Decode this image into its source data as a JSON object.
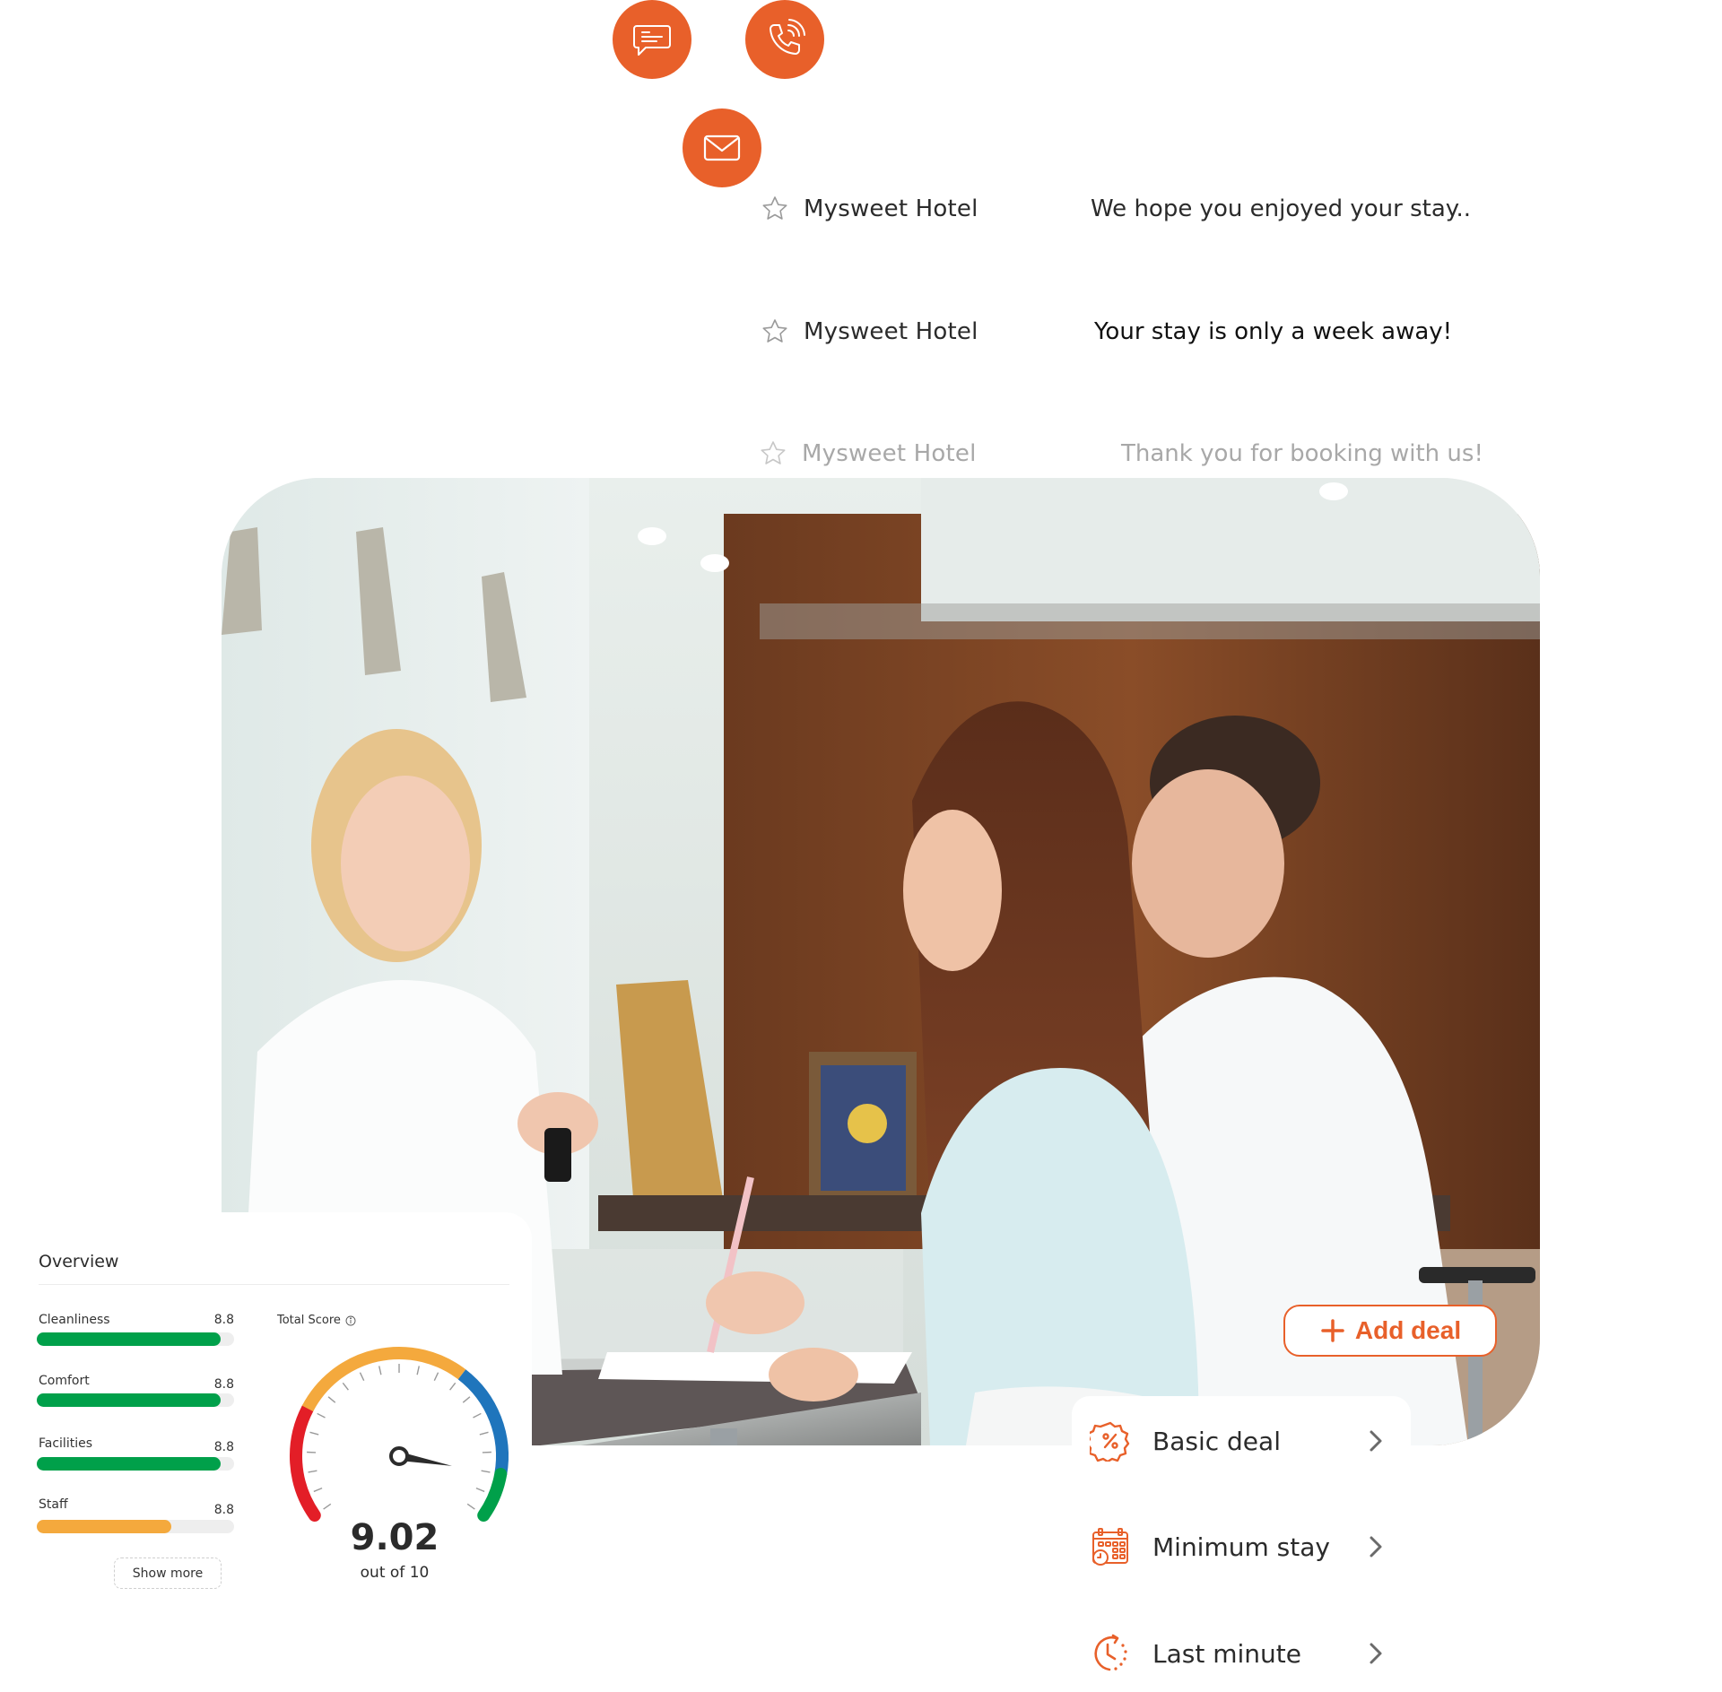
{
  "contact_actions": [
    {
      "label": "Chat",
      "icon": "chat-bubble-icon"
    },
    {
      "label": "Call",
      "icon": "phone-icon"
    },
    {
      "label": "Email",
      "icon": "mail-icon"
    }
  ],
  "messages": [
    {
      "sender": "Mysweet Hotel",
      "subject": "We hope you enjoyed your stay..",
      "starred": false
    },
    {
      "sender": "Mysweet Hotel",
      "subject": "Your stay is only a week away!",
      "starred": false
    },
    {
      "sender": "Mysweet Hotel",
      "subject": "Thank you for booking with us!",
      "starred": false
    }
  ],
  "photo": {
    "description": "Hotel receptionist handing a key card to a couple at the front desk"
  },
  "overview": {
    "title": "Overview",
    "metrics": [
      {
        "label": "Cleanliness",
        "value": "8.8",
        "fill_fraction": 0.93,
        "color": "#00A04A"
      },
      {
        "label": "Comfort",
        "value": "8.8",
        "fill_fraction": 0.93,
        "color": "#00A04A"
      },
      {
        "label": "Facilities",
        "value": "8.8",
        "fill_fraction": 0.93,
        "color": "#00A04A"
      },
      {
        "label": "Staff",
        "value": "8.8",
        "fill_fraction": 0.68,
        "color": "#F4A93D"
      }
    ],
    "show_more_label": "Show more",
    "total_score": {
      "label": "Total Score",
      "value": "9.02",
      "subtitle": "out of 10",
      "max": 10,
      "gauge_value": 9.02,
      "segments": [
        {
          "from": 0,
          "to": 2.5,
          "color": "#E31E27"
        },
        {
          "from": 2.5,
          "to": 6.5,
          "color": "#F4A93D"
        },
        {
          "from": 6.5,
          "to": 9.0,
          "color": "#1F75BC"
        },
        {
          "from": 9.0,
          "to": 10,
          "color": "#00A04A"
        }
      ]
    }
  },
  "deals": {
    "add_label": "Add deal",
    "items": [
      {
        "label": "Basic deal",
        "icon": "percent-badge-icon"
      },
      {
        "label": "Minimum stay",
        "icon": "calendar-clock-icon"
      },
      {
        "label": "Last minute",
        "icon": "clock-refresh-icon"
      }
    ]
  },
  "colors": {
    "accent": "#E8602A",
    "text": "#2b2b2b",
    "muted_text": "#a8a8a8"
  }
}
